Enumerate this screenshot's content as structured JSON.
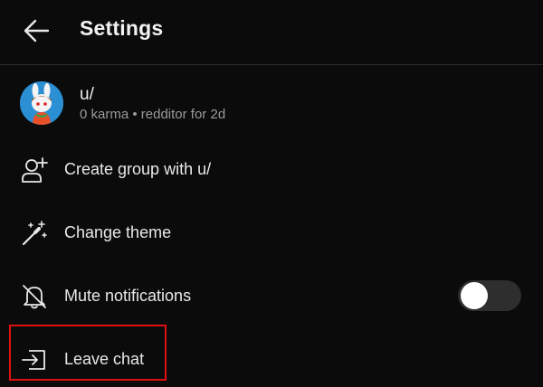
{
  "header": {
    "title": "Settings",
    "back_icon": "arrow-left-icon"
  },
  "profile": {
    "username": "u/",
    "meta": "0 karma • redditor for 2d",
    "avatar_icon": "snoo-avatar"
  },
  "menu": {
    "create_group": {
      "label": "Create group with u/",
      "icon": "add-user-icon"
    },
    "change_theme": {
      "label": "Change theme",
      "icon": "magic-wand-icon"
    },
    "mute": {
      "label": "Mute notifications",
      "icon": "bell-off-icon",
      "enabled": false
    },
    "leave": {
      "label": "Leave chat",
      "icon": "exit-icon"
    }
  },
  "colors": {
    "background": "#0b0b0b",
    "text": "#e8e8e8",
    "muted_text": "#9a9a9a",
    "highlight": "#e01010",
    "avatar_bg": "#2b8fd4"
  }
}
